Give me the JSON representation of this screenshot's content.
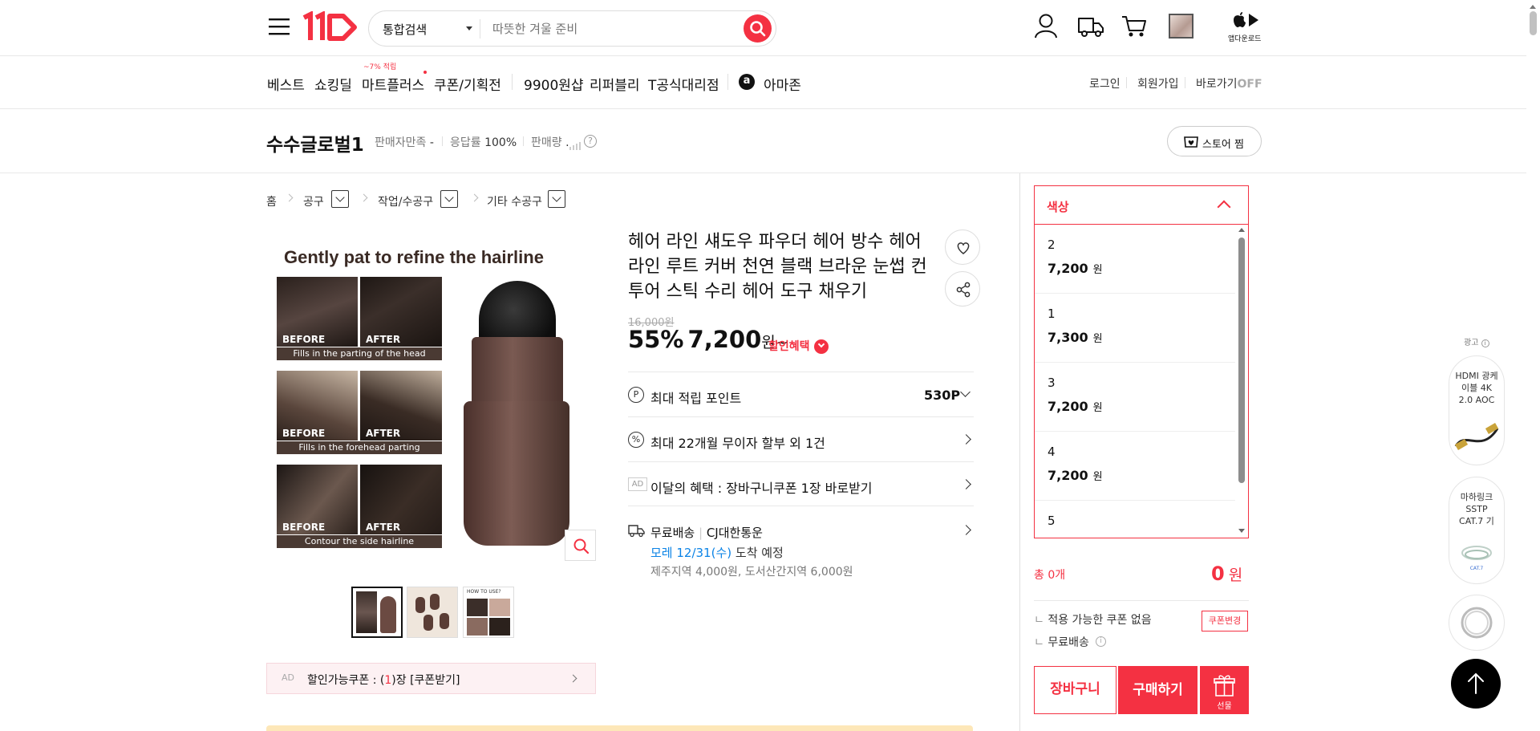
{
  "header": {
    "logo": "11",
    "search_category": "통합검색",
    "search_placeholder": "따뜻한 겨울 준비",
    "app_download": "앱다운로드"
  },
  "nav": {
    "items": [
      "베스트",
      "쇼킹딜",
      "마트플러스",
      "쿠폰/기획전",
      "9900원샵",
      "리퍼블리",
      "T공식대리점",
      "아마존"
    ],
    "mart_badge": "~7% 적립",
    "amazon_letter": "a",
    "login": "로그인",
    "signup": "회원가입",
    "shortcut": "바로가기",
    "shortcut_state": "OFF"
  },
  "seller": {
    "name": "수수글로벌1",
    "satisfaction_label": "판매자만족",
    "satisfaction_value": "-",
    "response_label": "응답률",
    "response_value": "100%",
    "sales_label": "판매량",
    "store_button": "스토어 찜"
  },
  "breadcrumb": [
    "홈",
    "공구",
    "작업/수공구",
    "기타 수공구"
  ],
  "product": {
    "image_headline": "Gently pat to refine the hairline",
    "image_captions": [
      "Fills in the parting of the head",
      "Fills in the forehead parting",
      "Contour the side hairline"
    ],
    "before": "BEFORE",
    "after": "AFTER",
    "thumb3_label": "HOW TO USE?",
    "title": "헤어 라인 섀도우 파우더 헤어 방수 헤어 라인 루트 커버 천연 블랙 브라운 눈썹 컨투어 스틱 수리 헤어 도구 채우기",
    "original_price": "16,000원",
    "discount": "55%",
    "price": "7,200",
    "price_unit": "원~",
    "discount_benefit": "할인혜택",
    "points_label": "최대 적립 포인트",
    "points_value": "530P",
    "installment": "최대 22개월 무이자 할부 외 1건",
    "ad_tag": "AD",
    "monthly_benefit": "이달의 혜택 : 장바구니쿠폰 1장 바로받기",
    "shipping_free": "무료배송",
    "shipping_courier": "CJ대한통운",
    "arrival_date": "모레 12/31(수)",
    "arrival_text": "도착 예정",
    "extra_fee": "제주지역 4,000원, 도서산간지역 6,000원",
    "coupon_ad": "AD",
    "coupon_text_pre": "할인가능쿠폰 : (",
    "coupon_count": "1",
    "coupon_text_post": ")장 [쿠폰받기]"
  },
  "options": {
    "header": "색상",
    "items": [
      {
        "name": "2",
        "price": "7,200",
        "unit": "원"
      },
      {
        "name": "1",
        "price": "7,300",
        "unit": "원"
      },
      {
        "name": "3",
        "price": "7,200",
        "unit": "원"
      },
      {
        "name": "4",
        "price": "7,200",
        "unit": "원"
      },
      {
        "name": "5",
        "price": "",
        "unit": ""
      }
    ]
  },
  "summary": {
    "total_label": "총 0개",
    "total_price": "0",
    "total_unit": "원",
    "coupon_none": "적용 가능한 쿠폰 없음",
    "coupon_change": "쿠폰변경",
    "free_shipping": "무료배송",
    "cart_button": "장바구니",
    "buy_button": "구매하기",
    "gift_label": "선물"
  },
  "side_ads": {
    "label": "광고",
    "ad1": "HDMI 광케이블 4K 2.0 AOC",
    "ad2": "마하링크 SSTP CAT.7 기",
    "ad2_small": "CAT.7"
  },
  "colors": {
    "brand": "#f43142",
    "link_blue": "#0b83e6"
  }
}
